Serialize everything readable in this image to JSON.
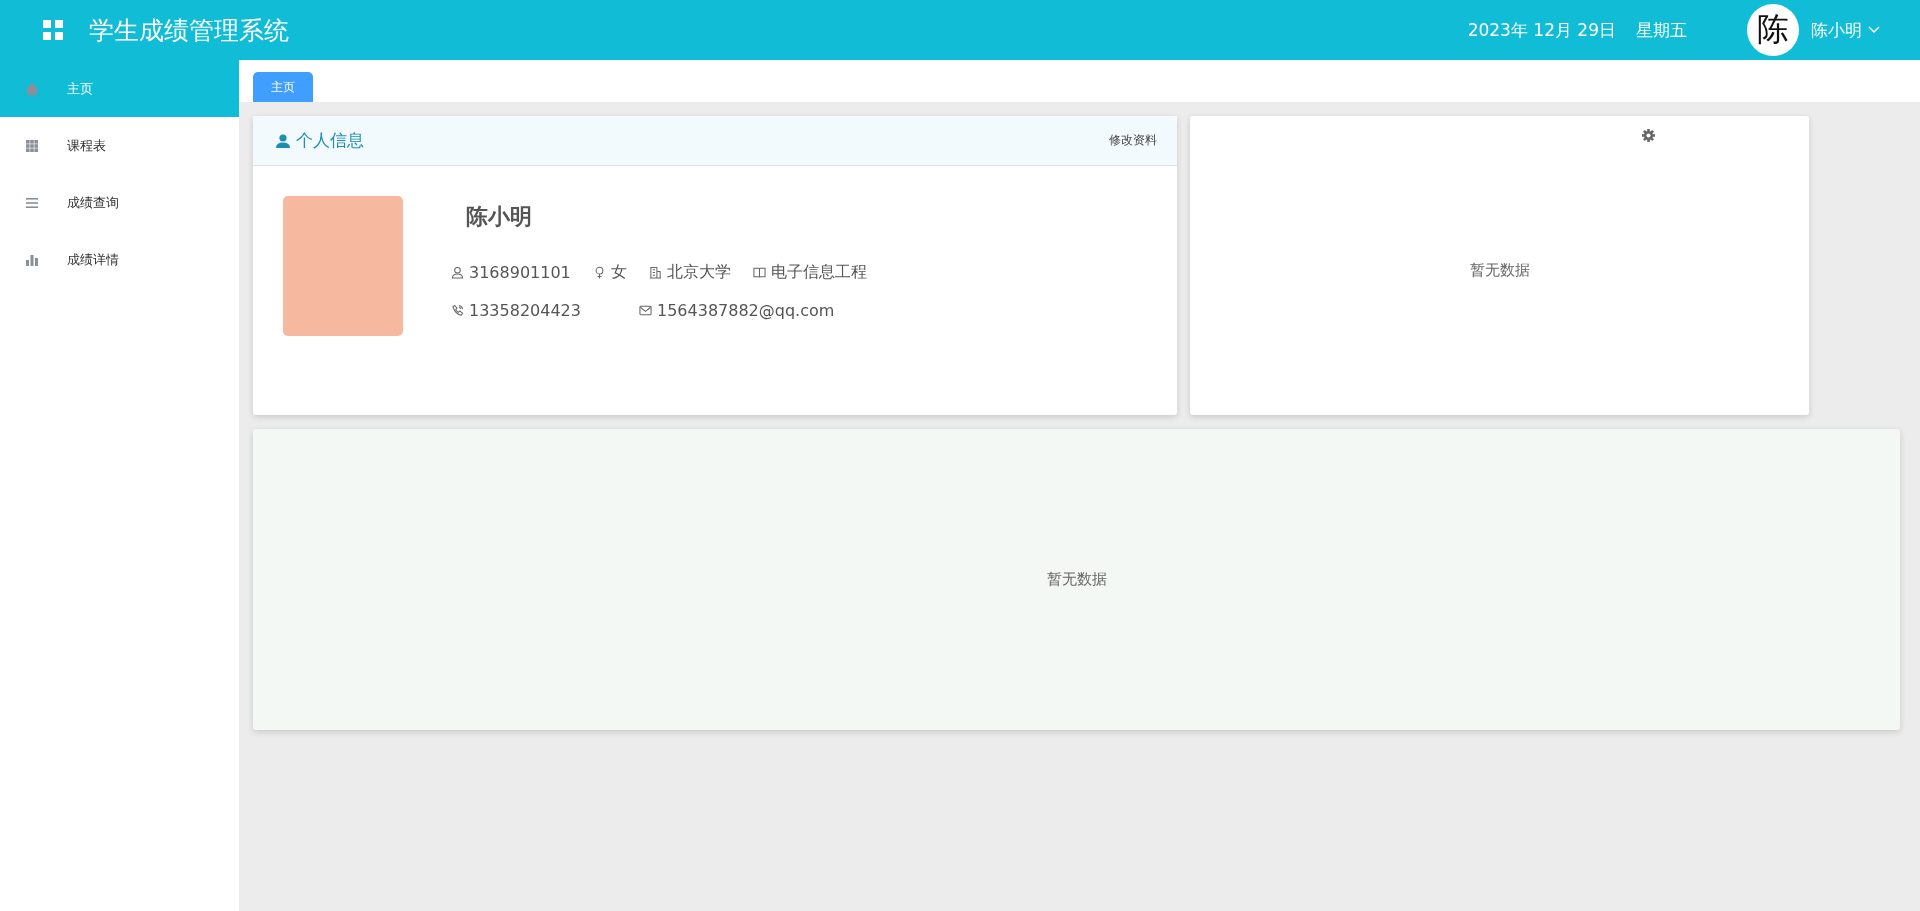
{
  "header": {
    "title": "学生成绩管理系统",
    "date": "2023年 12月 29日",
    "weekday": "星期五",
    "avatar_text": "陈",
    "user_name": "陈小明"
  },
  "sidebar": {
    "items": [
      {
        "label": "主页",
        "kind": "home",
        "selected": true
      },
      {
        "label": "课程表",
        "kind": "schedule",
        "selected": false
      },
      {
        "label": "成绩查询",
        "kind": "query",
        "selected": false
      },
      {
        "label": "成绩详情",
        "kind": "detail",
        "selected": false
      }
    ]
  },
  "tabs": [
    {
      "label": "主页",
      "selected": true
    }
  ],
  "profile_card": {
    "title": "个人信息",
    "edit_link": "修改资料",
    "name": "陈小明",
    "identity": [
      {
        "kind": "user",
        "text": "3168901101"
      },
      {
        "kind": "gender",
        "text": "女"
      },
      {
        "kind": "school",
        "text": "北京大学"
      },
      {
        "kind": "book",
        "text": "电子信息工程"
      }
    ],
    "contact": [
      {
        "kind": "phone",
        "text": "13358204423"
      },
      {
        "kind": "mail",
        "text": "1564387882@qq.com"
      }
    ]
  },
  "chart_card": {
    "empty_text": "暂无数据"
  },
  "bottom_card": {
    "empty_text": "暂无数据"
  }
}
